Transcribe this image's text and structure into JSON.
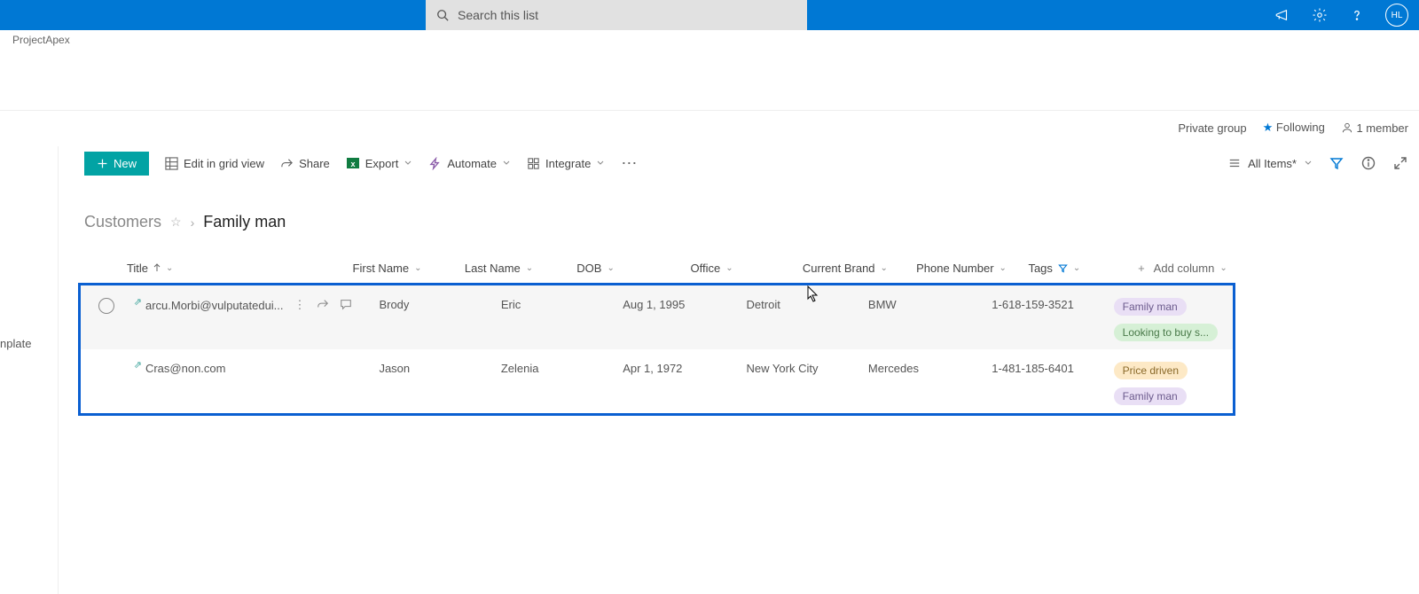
{
  "app": {
    "name": "ProjectApex",
    "sidebar_stub": "nplate"
  },
  "search": {
    "placeholder": "Search this list"
  },
  "user": {
    "initials": "HL"
  },
  "info": {
    "group_type": "Private group",
    "follow_label": "Following",
    "member_count": "1 member"
  },
  "commands": {
    "new": "New",
    "edit_grid": "Edit in grid view",
    "share": "Share",
    "export": "Export",
    "automate": "Automate",
    "integrate": "Integrate",
    "view_name": "All Items*"
  },
  "breadcrumb": {
    "parent": "Customers",
    "current": "Family man"
  },
  "columns": {
    "title": "Title",
    "first_name": "First Name",
    "last_name": "Last Name",
    "dob": "DOB",
    "office": "Office",
    "brand": "Current Brand",
    "phone": "Phone Number",
    "tags": "Tags",
    "add": "Add column"
  },
  "rows": [
    {
      "title": "arcu.Morbi@vulputatedui...",
      "first_name": "Brody",
      "last_name": "Eric",
      "dob": "Aug 1, 1995",
      "office": "Detroit",
      "brand": "BMW",
      "phone": "1-618-159-3521",
      "tags": [
        {
          "label": "Family man",
          "cls": "tag-family"
        },
        {
          "label": "Looking to buy s...",
          "cls": "tag-looking"
        }
      ],
      "hovered": true
    },
    {
      "title": "Cras@non.com",
      "first_name": "Jason",
      "last_name": "Zelenia",
      "dob": "Apr 1, 1972",
      "office": "New York City",
      "brand": "Mercedes",
      "phone": "1-481-185-6401",
      "tags": [
        {
          "label": "Price driven",
          "cls": "tag-price"
        },
        {
          "label": "Family man",
          "cls": "tag-family"
        }
      ],
      "hovered": false
    }
  ]
}
